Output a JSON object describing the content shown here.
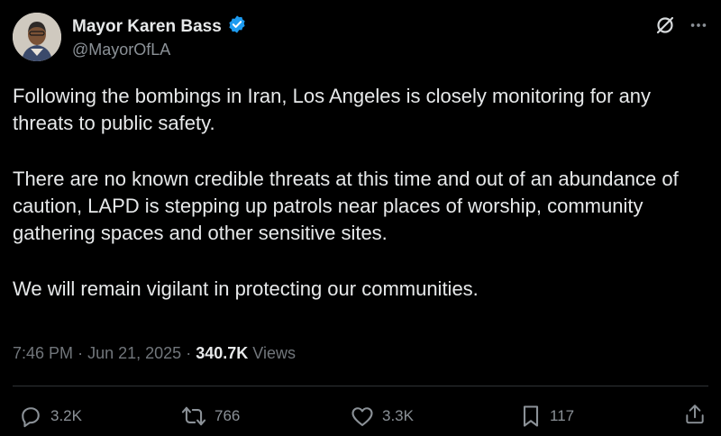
{
  "author": {
    "display_name": "Mayor Karen Bass",
    "handle": "@MayorOfLA",
    "verified": true,
    "verified_color": "#1d9bf0"
  },
  "header_icons": [
    "grok-slash-icon",
    "more-icon"
  ],
  "tweet": {
    "paragraphs": [
      "Following the bombings in Iran, Los Angeles is closely monitoring for any threats to public safety.",
      "There are no known credible threats at this time and out of an abundance of caution, LAPD is stepping up patrols near places of worship, community gathering spaces and other sensitive sites.",
      "We will remain vigilant in protecting our communities."
    ],
    "time": "7:46 PM",
    "separator": "·",
    "date": "Jun 21, 2025",
    "views_count": "340.7K",
    "views_label": "Views"
  },
  "actions": {
    "replies": "3.2K",
    "reposts": "766",
    "likes": "3.3K",
    "bookmarks": "117"
  },
  "colors": {
    "background": "#000000",
    "text": "#e7e9ea",
    "muted": "#71767b",
    "divider": "#2f3336"
  }
}
